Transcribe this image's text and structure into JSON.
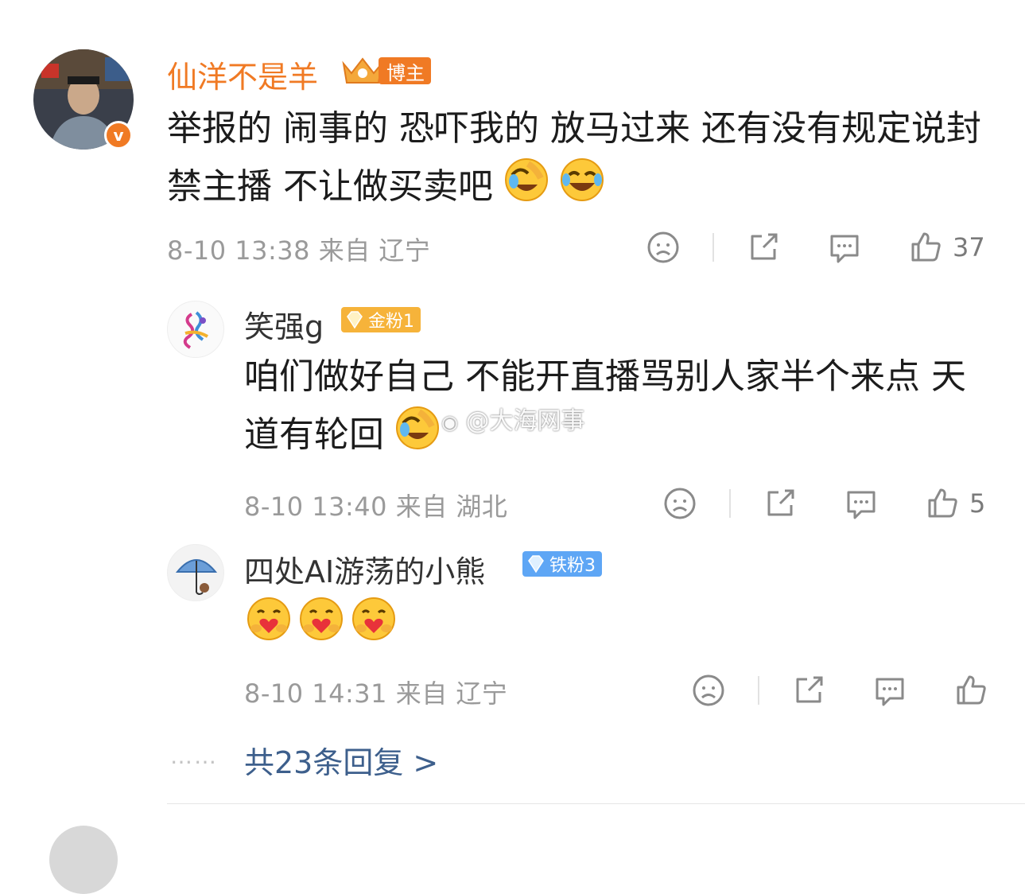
{
  "comment": {
    "author": "仙洋不是羊",
    "author_badge": "博主",
    "text": "举报的 闹事的 恐吓我的 放马过来 还有没有规定说封禁主播 不让做买卖吧",
    "meta": "8-10 13:38 来自 辽宁",
    "likes": "37",
    "verified_mark": "v"
  },
  "replies": [
    {
      "author": "笑强g",
      "badge": "金粉1",
      "badge_color": "#f6b33a",
      "text": "咱们做好自己  不能开直播骂别人家半个来点   天道有轮回",
      "meta": "8-10 13:40 来自 湖北",
      "likes": "5"
    },
    {
      "author": "四处AI游荡的小熊",
      "badge": "铁粉3",
      "badge_color": "#5ea6f5",
      "text": "",
      "meta": "8-10 14:31 来自 辽宁",
      "likes": ""
    }
  ],
  "more_replies": "共23条回复 >",
  "dots": "……",
  "watermark": "@大海网事",
  "colors": {
    "author_name": "#f07a24",
    "reply_name": "#333333",
    "link": "#3d5f8c",
    "meta": "#9a9a9a"
  },
  "icons": [
    "sad-face-icon",
    "share-icon",
    "comment-icon",
    "like-icon",
    "laugh-cry-emoji",
    "hug-emoji"
  ]
}
